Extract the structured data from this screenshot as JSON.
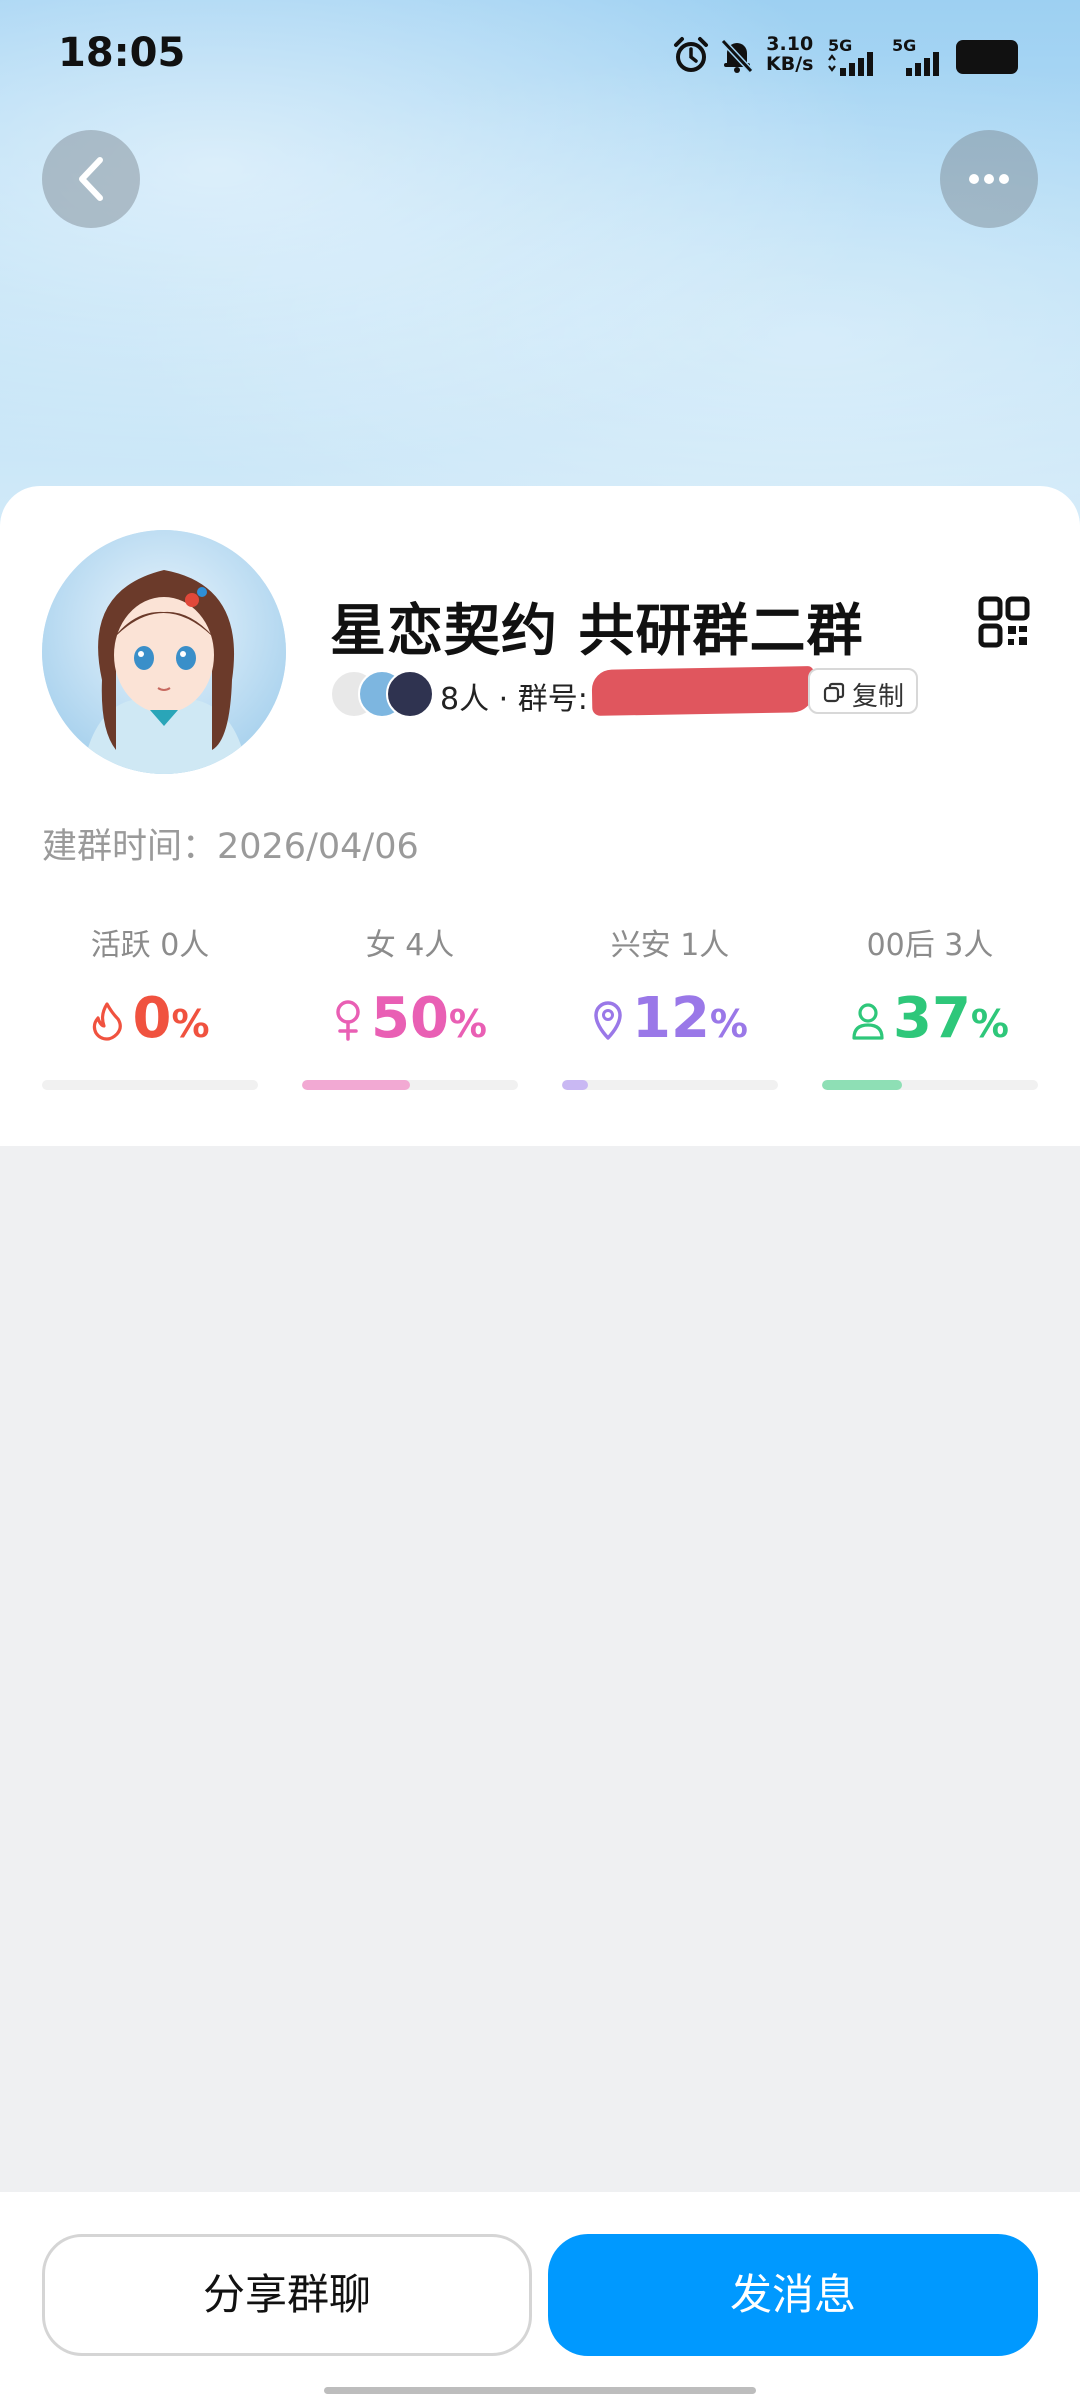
{
  "status_bar": {
    "time": "18:05",
    "net_speed_value": "3.10",
    "net_speed_unit": "KB/s",
    "network_1": "5G",
    "network_2": "5G",
    "icons": [
      "alarm-icon",
      "bell-muted-icon",
      "signal-icon",
      "signal-icon",
      "battery-icon"
    ]
  },
  "nav": {
    "back_icon": "chevron-left-icon",
    "more_icon": "more-dots-icon"
  },
  "group": {
    "name": "星恋契约 共研群二群",
    "members": "8人 · 群号:",
    "copy_label": "复制",
    "created_label": "建群时间：2026/04/06"
  },
  "stats": [
    {
      "label": "活跃 0人",
      "value": "0",
      "unit": "%",
      "icon": "flame-icon",
      "color": "#F0523F",
      "percent": 0
    },
    {
      "label": "女 4人",
      "value": "50",
      "unit": "%",
      "icon": "female-icon",
      "color": "#E95FB4",
      "percent": 50
    },
    {
      "label": "兴安 1人",
      "value": "12",
      "unit": "%",
      "icon": "location-icon",
      "color": "#9A78E8",
      "percent": 12
    },
    {
      "label": "00后 3人",
      "value": "37",
      "unit": "%",
      "icon": "person-icon",
      "color": "#2EC77A",
      "percent": 37
    }
  ],
  "actions": {
    "share_label": "分享群聊",
    "send_label": "发消息"
  },
  "colors": {
    "primary": "#0099FF",
    "background": "#EFF0F2"
  }
}
